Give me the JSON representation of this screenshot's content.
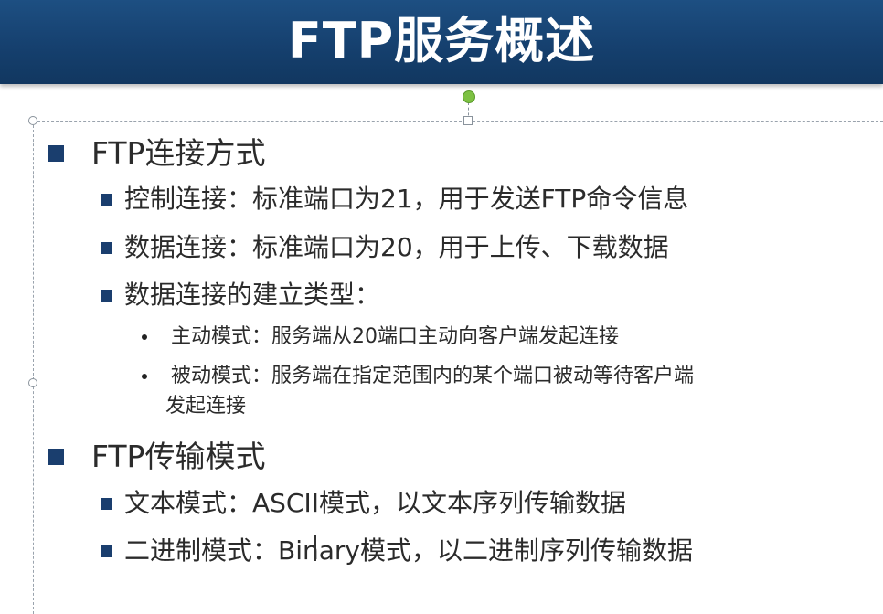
{
  "slide": {
    "title": "FTP服务概述"
  },
  "sections": [
    {
      "heading": "FTP连接方式",
      "items": [
        "控制连接：标准端口为21，用于发送FTP命令信息",
        "数据连接：标准端口为20，用于上传、下载数据",
        "数据连接的建立类型："
      ],
      "subitems": [
        "主动模式：服务端从20端口主动向客户端发起连接",
        "被动模式：服务端在指定范围内的某个端口被动等待客户端",
        "发起连接"
      ]
    },
    {
      "heading": "FTP传输模式",
      "items": [
        "文本模式：ASCII模式，以文本序列传输数据",
        "二进制模式：Binary模式，以二进制序列传输数据"
      ]
    }
  ],
  "colors": {
    "title_bar": "#153f6d",
    "bullet": "#1a3e6e",
    "rotate_handle": "#7dc142"
  }
}
